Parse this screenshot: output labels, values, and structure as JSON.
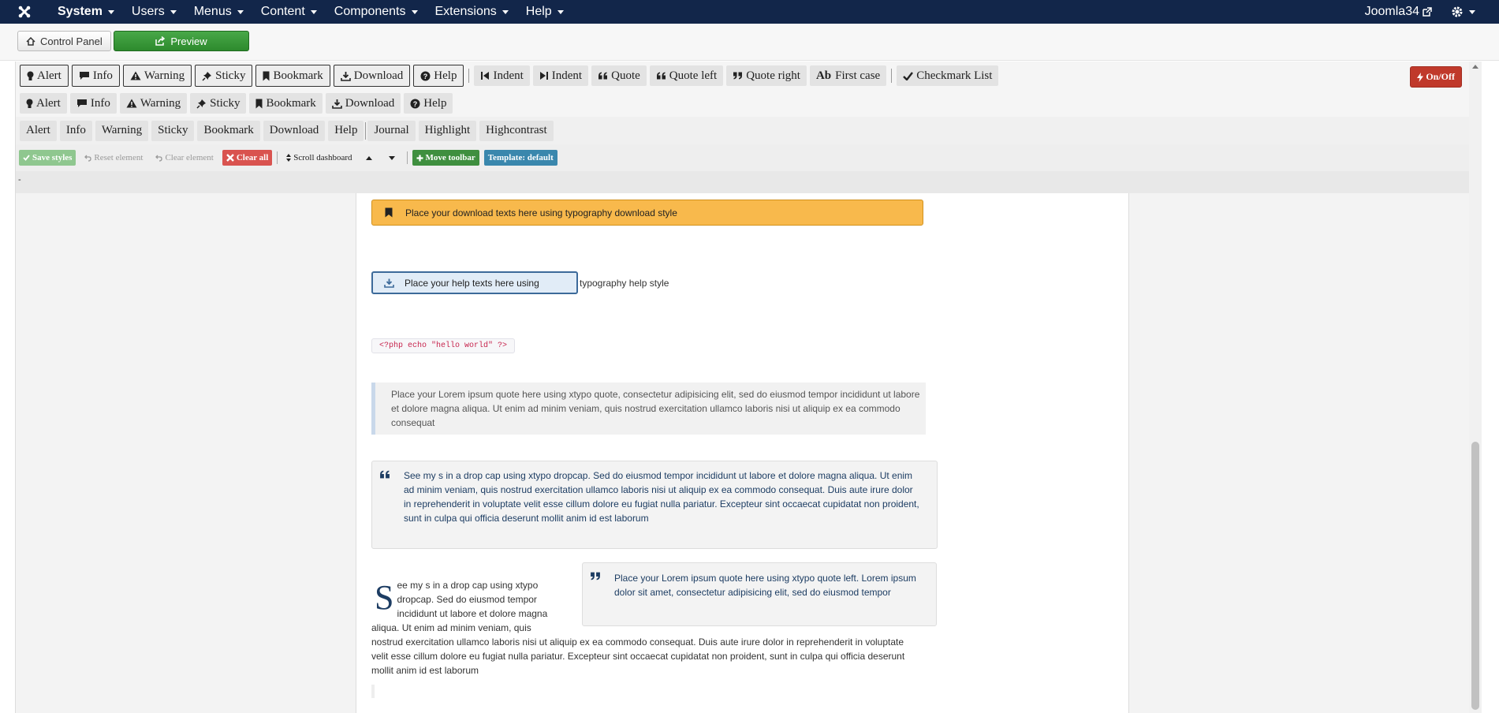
{
  "navbar": {
    "menu": [
      {
        "label": "System",
        "active": true
      },
      {
        "label": "Users",
        "active": false
      },
      {
        "label": "Menus",
        "active": false
      },
      {
        "label": "Content",
        "active": false
      },
      {
        "label": "Components",
        "active": false
      },
      {
        "label": "Extensions",
        "active": false
      },
      {
        "label": "Help",
        "active": false
      }
    ],
    "user": "Joomla34"
  },
  "subhead": {
    "control_panel": "Control Panel",
    "preview": "Preview"
  },
  "toolbar1": {
    "alert": "Alert",
    "info": "Info",
    "warning": "Warning",
    "sticky": "Sticky",
    "bookmark": "Bookmark",
    "download": "Download",
    "help": "Help",
    "indent1": "Indent",
    "indent2": "Indent",
    "quote": "Quote",
    "quote_left": "Quote left",
    "quote_right": "Quote right",
    "first_case_icon": "Ab",
    "first_case": "First case",
    "checkmark_list": "Checkmark List",
    "onoff": "On/Off"
  },
  "toolbar2": {
    "alert": "Alert",
    "info": "Info",
    "warning": "Warning",
    "sticky": "Sticky",
    "bookmark": "Bookmark",
    "download": "Download",
    "help": "Help"
  },
  "toolbar3": {
    "alert": "Alert",
    "info": "Info",
    "warning": "Warning",
    "sticky": "Sticky",
    "bookmark": "Bookmark",
    "download": "Download",
    "help": "Help",
    "journal": "Journal",
    "highlight": "Highlight",
    "highcontrast": "Highcontrast"
  },
  "toolbar4": {
    "save_styles": "Save styles",
    "reset_element": "Reset element",
    "clear_element": "Clear element",
    "clear_all": "Clear all",
    "scroll_dashboard": "Scroll dashboard",
    "move_toolbar": "Move toolbar",
    "template": "Template: default"
  },
  "path": "-",
  "content": {
    "download_text": "Place your download texts here using typography download style",
    "help_text": "Place your help texts here using",
    "help_rest": "typography help style",
    "code": "<?php echo \"hello world\" ?>",
    "quote_text": "Place your Lorem ipsum quote here using xtypo quote, consectetur adipisicing elit, sed do eiusmod tempor incididunt ut labore et dolore magna aliqua. Ut enim ad minim veniam, quis nostrud exercitation ullamco laboris nisi ut aliquip ex ea commodo consequat",
    "dropcap_quote": "See my s in a drop cap using xtypo dropcap. Sed do eiusmod tempor incididunt ut labore et dolore magna aliqua. Ut enim ad minim veniam, quis nostrud exercitation ullamco laboris nisi ut aliquip ex ea commodo consequat. Duis aute irure dolor in reprehenderit in voluptate velit esse cillum dolore eu fugiat nulla pariatur. Excepteur sint occaecat cupidatat non proident, sunt in culpa qui officia deserunt mollit anim id est laborum",
    "dropcap_letter": "S",
    "para_top": "ee my s in a drop cap using xtypo dropcap. Sed do eiusmod tempor incididunt ut labore et dolore magna aliqua. Ut enim ad minim veniam, quis",
    "para_bottom": "nostrud exercitation ullamco laboris nisi ut aliquip ex ea commodo consequat. Duis aute irure dolor in reprehenderit in voluptate velit esse cillum dolore eu fugiat nulla pariatur. Excepteur sint occaecat cupidatat non proident, sunt in culpa qui officia deserunt mollit anim id est laborum",
    "quote_left_text": "Place your Lorem ipsum quote here using xtypo quote left. Lorem ipsum dolor sit amet, consectetur adipisicing elit, sed do eiusmod tempor"
  }
}
